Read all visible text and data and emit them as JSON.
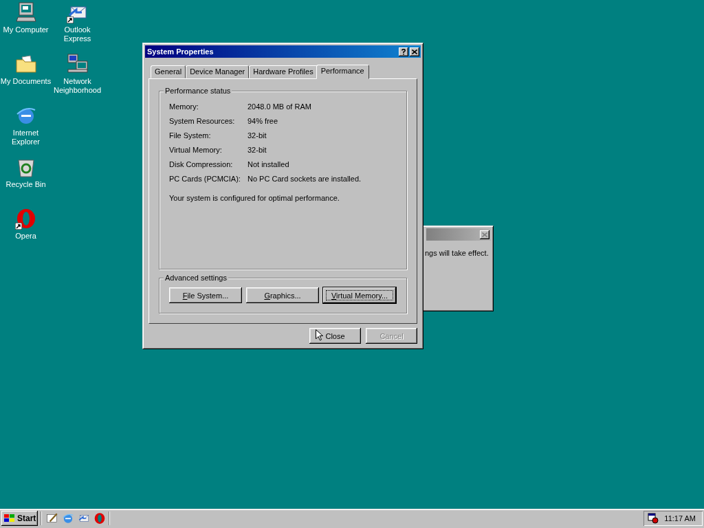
{
  "desktop_icons": [
    {
      "label": "My Computer",
      "kind": "computer",
      "shortcut": false
    },
    {
      "label": "Outlook Express",
      "kind": "mail",
      "shortcut": true
    },
    {
      "label": "My Documents",
      "kind": "folder",
      "shortcut": false
    },
    {
      "label": "Network Neighborhood",
      "kind": "network",
      "shortcut": false
    },
    {
      "label": "Internet Explorer",
      "kind": "browser",
      "shortcut": false
    },
    {
      "label": "Recycle Bin",
      "kind": "recycle",
      "shortcut": false
    },
    {
      "label": "Opera",
      "kind": "opera",
      "shortcut": true
    }
  ],
  "background_dialog": {
    "message": "ngs will take effect."
  },
  "window": {
    "title": "System Properties",
    "tabs": [
      {
        "label": "General",
        "selected": false
      },
      {
        "label": "Device Manager",
        "selected": false
      },
      {
        "label": "Hardware Profiles",
        "selected": false
      },
      {
        "label": "Performance",
        "selected": true
      }
    ],
    "status_group": {
      "title": "Performance status",
      "rows": [
        {
          "label": "Memory:",
          "value": "2048.0 MB of RAM"
        },
        {
          "label": "System Resources:",
          "value": "94% free"
        },
        {
          "label": "File System:",
          "value": "32-bit"
        },
        {
          "label": "Virtual Memory:",
          "value": "32-bit"
        },
        {
          "label": "Disk Compression:",
          "value": "Not installed"
        },
        {
          "label": "PC Cards (PCMCIA):",
          "value": "No PC Card sockets are installed."
        }
      ],
      "message": "Your system is configured for optimal performance."
    },
    "advanced_group": {
      "title": "Advanced settings",
      "buttons": [
        {
          "label": "File System...",
          "focused": false
        },
        {
          "label": "Graphics...",
          "focused": false
        },
        {
          "label": "Virtual Memory...",
          "focused": true
        }
      ]
    },
    "footer_buttons": [
      {
        "label": "Close",
        "disabled": false
      },
      {
        "label": "Cancel",
        "disabled": true
      }
    ]
  },
  "taskbar": {
    "start": "Start",
    "quick_launch": [
      {
        "kind": "desktop"
      },
      {
        "kind": "browser"
      },
      {
        "kind": "mail"
      },
      {
        "kind": "opera"
      }
    ],
    "clock": "11:17 AM"
  }
}
